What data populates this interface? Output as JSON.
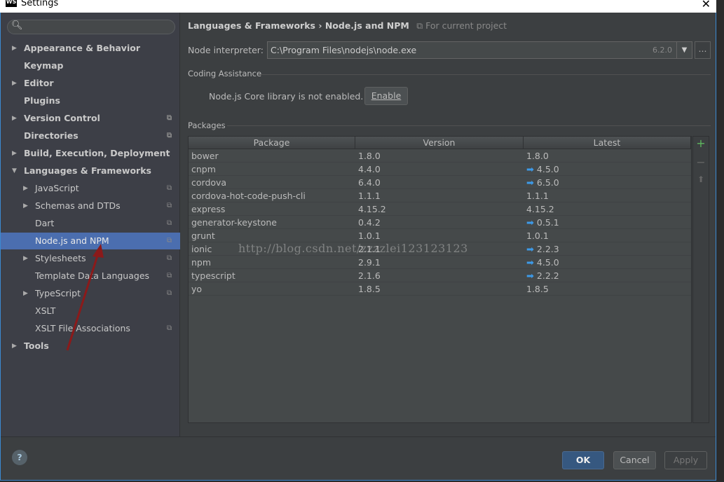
{
  "window": {
    "title": "Settings",
    "logo": "WS"
  },
  "sidebar": {
    "items": [
      {
        "label": "Appearance & Behavior",
        "bold": true,
        "arrow": "right",
        "level": 0,
        "copy": false
      },
      {
        "label": "Keymap",
        "bold": true,
        "arrow": "",
        "level": 0,
        "copy": false
      },
      {
        "label": "Editor",
        "bold": true,
        "arrow": "right",
        "level": 0,
        "copy": false
      },
      {
        "label": "Plugins",
        "bold": true,
        "arrow": "",
        "level": 0,
        "copy": false
      },
      {
        "label": "Version Control",
        "bold": true,
        "arrow": "right",
        "level": 0,
        "copy": true
      },
      {
        "label": "Directories",
        "bold": true,
        "arrow": "",
        "level": 0,
        "copy": true
      },
      {
        "label": "Build, Execution, Deployment",
        "bold": true,
        "arrow": "right",
        "level": 0,
        "copy": false
      },
      {
        "label": "Languages & Frameworks",
        "bold": true,
        "arrow": "down",
        "level": 0,
        "copy": false
      },
      {
        "label": "JavaScript",
        "bold": false,
        "arrow": "right",
        "level": 1,
        "copy": true
      },
      {
        "label": "Schemas and DTDs",
        "bold": false,
        "arrow": "right",
        "level": 1,
        "copy": true
      },
      {
        "label": "Dart",
        "bold": false,
        "arrow": "",
        "level": 1,
        "copy": true
      },
      {
        "label": "Node.js and NPM",
        "bold": false,
        "arrow": "",
        "level": 1,
        "copy": true,
        "selected": true
      },
      {
        "label": "Stylesheets",
        "bold": false,
        "arrow": "right",
        "level": 1,
        "copy": true
      },
      {
        "label": "Template Data Languages",
        "bold": false,
        "arrow": "",
        "level": 1,
        "copy": true
      },
      {
        "label": "TypeScript",
        "bold": false,
        "arrow": "right",
        "level": 1,
        "copy": true
      },
      {
        "label": "XSLT",
        "bold": false,
        "arrow": "",
        "level": 1,
        "copy": false
      },
      {
        "label": "XSLT File Associations",
        "bold": false,
        "arrow": "",
        "level": 1,
        "copy": true
      },
      {
        "label": "Tools",
        "bold": true,
        "arrow": "right",
        "level": 0,
        "copy": false
      }
    ]
  },
  "breadcrumb": {
    "parent": "Languages & Frameworks",
    "sep": "›",
    "current": "Node.js and NPM",
    "scope": "For current project"
  },
  "interpreter": {
    "label": "Node interpreter:",
    "value": "C:\\Program Files\\nodejs\\node.exe",
    "version": "6.2.0",
    "browse": "..."
  },
  "coding": {
    "title": "Coding Assistance",
    "message": "Node.js Core library is not enabled.",
    "enable": "Enable"
  },
  "packages": {
    "title": "Packages",
    "columns": [
      "Package",
      "Version",
      "Latest"
    ],
    "rows": [
      {
        "name": "bower",
        "version": "1.8.0",
        "latest": "1.8.0",
        "upgrade": false
      },
      {
        "name": "cnpm",
        "version": "4.4.0",
        "latest": "4.5.0",
        "upgrade": true
      },
      {
        "name": "cordova",
        "version": "6.4.0",
        "latest": "6.5.0",
        "upgrade": true
      },
      {
        "name": "cordova-hot-code-push-cli",
        "version": "1.1.1",
        "latest": "1.1.1",
        "upgrade": false
      },
      {
        "name": "express",
        "version": "4.15.2",
        "latest": "4.15.2",
        "upgrade": false
      },
      {
        "name": "generator-keystone",
        "version": "0.4.2",
        "latest": "0.5.1",
        "upgrade": true
      },
      {
        "name": "grunt",
        "version": "1.0.1",
        "latest": "1.0.1",
        "upgrade": false
      },
      {
        "name": "ionic",
        "version": "2.1.1",
        "latest": "2.2.3",
        "upgrade": true
      },
      {
        "name": "npm",
        "version": "2.9.1",
        "latest": "4.5.0",
        "upgrade": true
      },
      {
        "name": "typescript",
        "version": "2.1.6",
        "latest": "2.2.2",
        "upgrade": true
      },
      {
        "name": "yo",
        "version": "1.8.5",
        "latest": "1.8.5",
        "upgrade": false
      }
    ]
  },
  "footer": {
    "help": "?",
    "ok": "OK",
    "cancel": "Cancel",
    "apply": "Apply"
  },
  "watermark": "http://blog.csdn.net/zzzzlei123123123",
  "colors": {
    "accent": "#4b6eaf",
    "upgrade_arrow": "#3d9ae8",
    "annotation_arrow": "#8b1a1a"
  }
}
